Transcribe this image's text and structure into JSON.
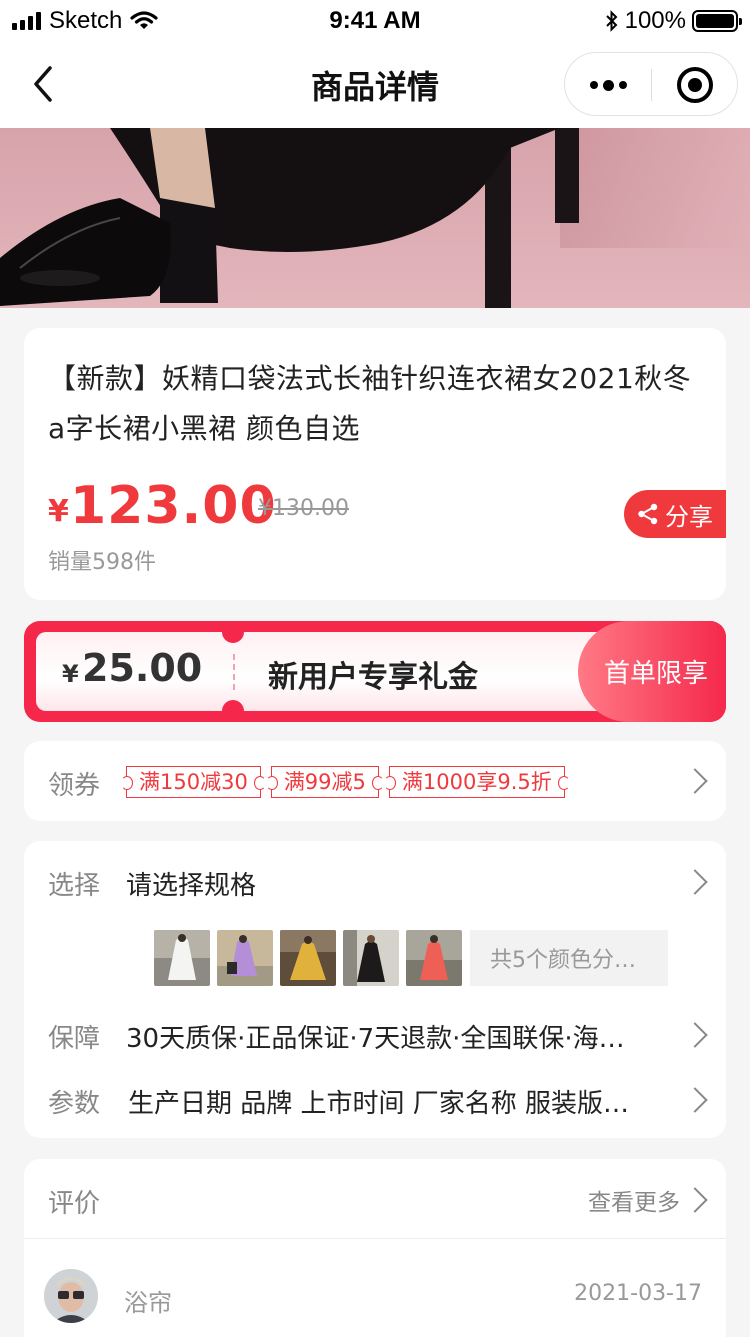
{
  "status_bar": {
    "carrier": "Sketch",
    "time": "9:41 AM",
    "battery": "100%",
    "battery_level": 1.0
  },
  "navbar": {
    "title": "商品详情",
    "back_icon": "chevron-left-icon",
    "more_icon": "more-dots-icon",
    "close_icon": "mini-program-close-icon"
  },
  "product": {
    "title": "【新款】妖精口袋法式长袖针织连衣裙女2021秋冬a字长裙小黑裙 颜色自选",
    "currency": "¥",
    "price": "123.00",
    "original_price": "¥130.00",
    "sales": "销量598件",
    "share_label": "分享",
    "price_color": "#f0393d"
  },
  "gift": {
    "currency": "¥",
    "amount": "25.00",
    "label": "新用户专享礼金",
    "tag": "首单限享",
    "color": "#f5284b"
  },
  "coupons": {
    "label": "领券",
    "tags": [
      "满150减30",
      "满99减5",
      "满1000享9.5折"
    ]
  },
  "spec": {
    "select_label": "选择",
    "select_value": "请选择规格",
    "colors_more": "共5个颜色分…",
    "guarantee_label": "保障",
    "guarantee_value": "30天质保·正品保证·7天退款·全国联保·海…",
    "params_label": "参数",
    "params_value": "生产日期 品牌 上市时间 厂家名称 服装版…"
  },
  "review": {
    "label": "评价",
    "more": "查看更多",
    "user": "浴帘",
    "date": "2021-03-17"
  }
}
